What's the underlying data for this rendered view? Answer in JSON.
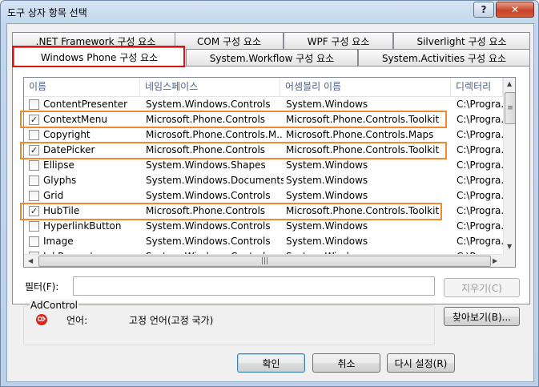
{
  "window": {
    "title": "도구 상자 항목 선택",
    "help_label": "?",
    "close_label": "✕"
  },
  "tabs_row1": [
    ".NET Framework 구성 요소",
    "COM 구성 요소",
    "WPF 구성 요소",
    "Silverlight 구성 요소"
  ],
  "tabs_row2": [
    "Windows Phone 구성 요소",
    "System.Workflow 구성 요소",
    "System.Activities 구성 요소"
  ],
  "active_tab": "Windows Phone 구성 요소",
  "list": {
    "columns": [
      "이름",
      "네임스페이스",
      "어셈블리 이름",
      "디렉터리"
    ],
    "rows": [
      {
        "checked": false,
        "name": "ContentPresenter",
        "namespace": "System.Windows.Controls",
        "assembly": "System.Windows",
        "directory": "C:\\Progra..."
      },
      {
        "checked": true,
        "name": "ContextMenu",
        "namespace": "Microsoft.Phone.Controls",
        "assembly": "Microsoft.Phone.Controls.Toolkit",
        "directory": "C:\\Progra..."
      },
      {
        "checked": false,
        "name": "Copyright",
        "namespace": "Microsoft.Phone.Controls.M...",
        "assembly": "Microsoft.Phone.Controls.Maps",
        "directory": "C:\\Progra..."
      },
      {
        "checked": true,
        "name": "DatePicker",
        "namespace": "Microsoft.Phone.Controls",
        "assembly": "Microsoft.Phone.Controls.Toolkit",
        "directory": "C:\\Progra..."
      },
      {
        "checked": false,
        "name": "Ellipse",
        "namespace": "System.Windows.Shapes",
        "assembly": "System.Windows",
        "directory": "C:\\Progra..."
      },
      {
        "checked": false,
        "name": "Glyphs",
        "namespace": "System.Windows.Documents",
        "assembly": "System.Windows",
        "directory": "C:\\Progra..."
      },
      {
        "checked": false,
        "name": "Grid",
        "namespace": "System.Windows.Controls",
        "assembly": "System.Windows",
        "directory": "C:\\Progra..."
      },
      {
        "checked": true,
        "name": "HubTile",
        "namespace": "Microsoft.Phone.Controls",
        "assembly": "Microsoft.Phone.Controls.Toolkit",
        "directory": "C:\\Progra..."
      },
      {
        "checked": false,
        "name": "HyperlinkButton",
        "namespace": "System.Windows.Controls",
        "assembly": "System.Windows",
        "directory": "C:\\Progra..."
      },
      {
        "checked": false,
        "name": "Image",
        "namespace": "System.Windows.Controls",
        "assembly": "System.Windows",
        "directory": "C:\\Progra..."
      },
      {
        "checked": false,
        "name": "InkPresenter",
        "namespace": "System.Windows.Controls",
        "assembly": "System.Windows",
        "directory": "C:\\Progra..."
      }
    ]
  },
  "filter": {
    "label": "필터(F):",
    "value": "",
    "clear_label": "지우기(C)"
  },
  "details": {
    "group_title": "AdControl",
    "language_label": "언어:",
    "language_value": "고정 언어(고정 국가)",
    "browse_label": "찾아보기(B)..."
  },
  "buttons": {
    "ok": "확인",
    "cancel": "취소",
    "reset": "다시 설정(R)"
  },
  "colors": {
    "highlight_red": "#e31212",
    "highlight_orange": "#f08a2c"
  }
}
